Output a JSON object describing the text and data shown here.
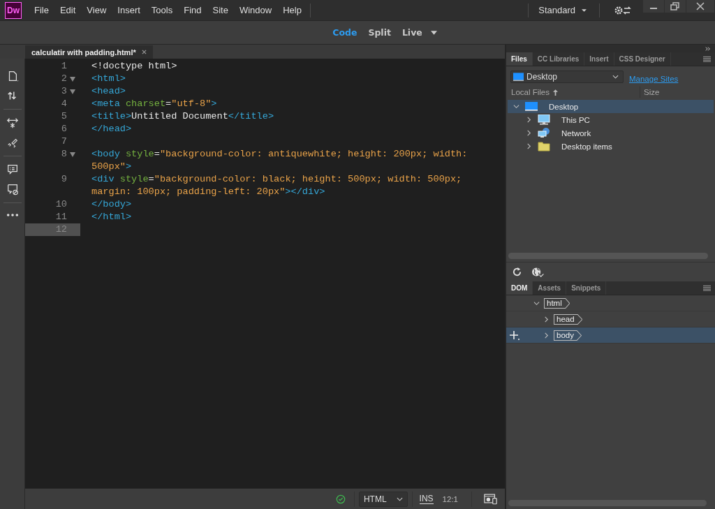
{
  "app": {
    "logo": "Dw",
    "menu": [
      "File",
      "Edit",
      "View",
      "Insert",
      "Tools",
      "Find",
      "Site",
      "Window",
      "Help"
    ],
    "workspace": "Standard"
  },
  "view_switcher": [
    {
      "label": "Code",
      "selected": true
    },
    {
      "label": "Split",
      "selected": false
    },
    {
      "label": "Live",
      "selected": false
    }
  ],
  "document_tab": {
    "title": "calculatir with padding.html*"
  },
  "editor": {
    "lines": [
      {
        "number": "1",
        "fold": false,
        "current": false,
        "tokens": [
          {
            "kind": "text",
            "text": "<!doctype html>"
          }
        ]
      },
      {
        "number": "2",
        "fold": true,
        "current": false,
        "tokens": [
          {
            "kind": "tag",
            "text": "<html>"
          }
        ]
      },
      {
        "number": "3",
        "fold": true,
        "current": false,
        "tokens": [
          {
            "kind": "tag",
            "text": "<head>"
          }
        ]
      },
      {
        "number": "4",
        "fold": false,
        "current": false,
        "tokens": [
          {
            "kind": "tag",
            "text": "<meta "
          },
          {
            "kind": "attr",
            "text": "charset"
          },
          {
            "kind": "text",
            "text": "="
          },
          {
            "kind": "string",
            "text": "\"utf-8\""
          },
          {
            "kind": "tag",
            "text": ">"
          }
        ]
      },
      {
        "number": "5",
        "fold": false,
        "current": false,
        "tokens": [
          {
            "kind": "tag",
            "text": "<title>"
          },
          {
            "kind": "text",
            "text": "Untitled Document"
          },
          {
            "kind": "tag",
            "text": "</title>"
          }
        ]
      },
      {
        "number": "6",
        "fold": false,
        "current": false,
        "tokens": [
          {
            "kind": "tag",
            "text": "</head>"
          }
        ]
      },
      {
        "number": "7",
        "fold": false,
        "current": false
      },
      {
        "number": "8",
        "fold": true,
        "current": false,
        "tokens": [
          {
            "kind": "tag",
            "text": "<body "
          },
          {
            "kind": "attr",
            "text": "style"
          },
          {
            "kind": "text",
            "text": "="
          },
          {
            "kind": "string",
            "text": "\"background-color: antiquewhite; height: 200px; width: 500px\""
          },
          {
            "kind": "tag",
            "text": ">"
          }
        ]
      },
      {
        "number": "9",
        "fold": false,
        "current": false,
        "tokens": [
          {
            "kind": "tag",
            "text": "<div "
          },
          {
            "kind": "attr",
            "text": "style"
          },
          {
            "kind": "text",
            "text": "="
          },
          {
            "kind": "string",
            "text": "\"background-color: black; height: 500px; width: 500px; margin: 100px; padding-left: 20px\""
          },
          {
            "kind": "tag",
            "text": "></div>"
          }
        ]
      },
      {
        "number": "10",
        "fold": false,
        "current": false,
        "tokens": [
          {
            "kind": "tag",
            "text": "</body>"
          }
        ]
      },
      {
        "number": "11",
        "fold": false,
        "current": false,
        "tokens": [
          {
            "kind": "tag",
            "text": "</html>"
          }
        ]
      },
      {
        "number": "12",
        "fold": false,
        "current": true
      }
    ]
  },
  "status_bar": {
    "language": "HTML",
    "mode": "INS",
    "position": "12:1"
  },
  "files_panel": {
    "tabs": [
      {
        "label": "Files",
        "selected": true
      },
      {
        "label": "CC Libraries",
        "selected": false
      },
      {
        "label": "Insert",
        "selected": false
      },
      {
        "label": "CSS Designer",
        "selected": false
      }
    ],
    "site": "Desktop",
    "manage_link": "Manage Sites",
    "columns": [
      "Local Files",
      "Size"
    ],
    "tree": [
      {
        "label": "Desktop",
        "kind": "desktop",
        "expanded": true,
        "selected": true,
        "children": [
          {
            "label": "This PC",
            "kind": "computer",
            "expanded": false,
            "selected": false
          },
          {
            "label": "Network",
            "kind": "network",
            "expanded": false,
            "selected": false
          },
          {
            "label": "Desktop items",
            "kind": "folder",
            "expanded": false,
            "selected": false
          }
        ]
      }
    ]
  },
  "dom_panel": {
    "tabs": [
      {
        "label": "DOM",
        "selected": true
      },
      {
        "label": "Assets",
        "selected": false
      },
      {
        "label": "Snippets",
        "selected": false
      }
    ],
    "tree": [
      {
        "label": "html",
        "expanded": true,
        "selected": false,
        "children": [
          {
            "label": "head",
            "expanded": false,
            "selected": false
          },
          {
            "label": "body",
            "expanded": false,
            "selected": true
          }
        ]
      }
    ]
  }
}
